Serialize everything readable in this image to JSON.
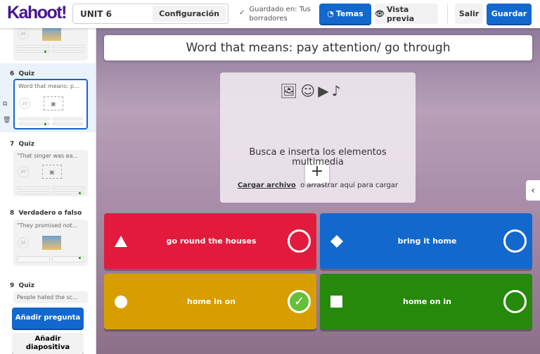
{
  "header": {
    "logo": "Kahoot!",
    "title": "UNIT 6",
    "settings": "Configuración",
    "saved": "Guardado en: Tus borradores",
    "themes": "Temas",
    "preview": "Vista previa",
    "exit": "Salir",
    "save": "Guardar"
  },
  "sidebar": {
    "slides": [
      {
        "num": "6",
        "type": "Quiz",
        "text": "Word that means: p...",
        "timer": "20"
      },
      {
        "num": "7",
        "type": "Quiz",
        "text": "\"That singer was ea...",
        "timer": "20"
      },
      {
        "num": "8",
        "type": "Verdadero o falso",
        "text": "\"They promised not...",
        "timer": "20"
      },
      {
        "num": "9",
        "type": "Quiz",
        "text": "People hated the sc..."
      }
    ],
    "prev_timer": "20",
    "add_question": "Añadir pregunta",
    "add_slide": "Añadir diapositiva"
  },
  "main": {
    "question": "Word that means: pay attention/ go through",
    "media": {
      "title": "Busca e inserta los elementos multimedia",
      "upload": "Cargar archivo",
      "drag": "o arrastrar aquí para cargar"
    },
    "answers": [
      {
        "text": "go round the houses",
        "color": "#e21b3c",
        "shape": "triangle",
        "correct": false
      },
      {
        "text": "bring it home",
        "color": "#1368ce",
        "shape": "diamond",
        "correct": false
      },
      {
        "text": "home in on",
        "color": "#d89e00",
        "shape": "circle",
        "correct": true
      },
      {
        "text": "home on in",
        "color": "#26890c",
        "shape": "square",
        "correct": false
      }
    ]
  }
}
